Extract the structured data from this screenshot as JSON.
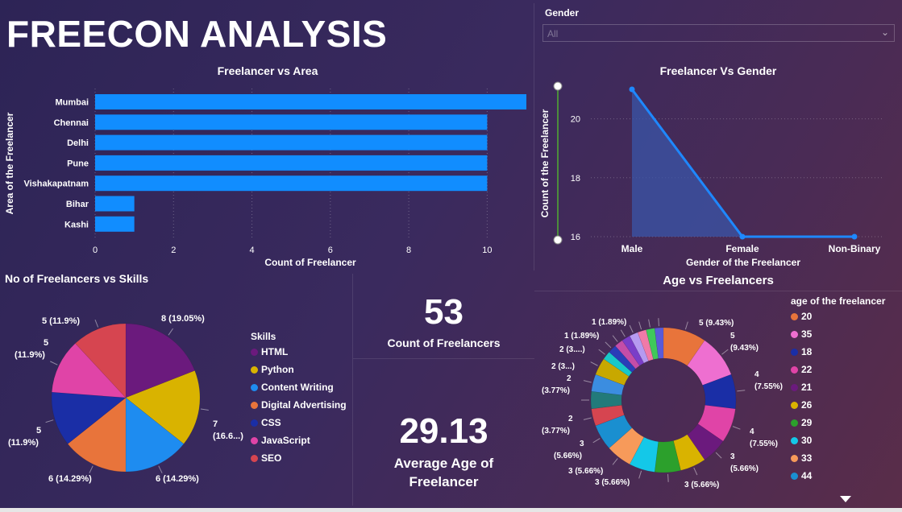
{
  "report_title": "FREECON ANALYSIS",
  "slicer": {
    "label": "Gender",
    "value": "All"
  },
  "cards": {
    "count": {
      "value": "53",
      "label": "Count of Freelancers"
    },
    "avg_age": {
      "value": "29.13",
      "label_line1": "Average Age of",
      "label_line2": "Freelancer"
    }
  },
  "colors": {
    "bar": "#118dff",
    "line": "#1e88ff",
    "area": "#3a56a8"
  },
  "chart_data": [
    {
      "id": "area",
      "type": "bar",
      "orientation": "horizontal",
      "title": "Freelancer vs Area",
      "xlabel": "Count of Freelancer",
      "ylabel": "Area of the Freelancer",
      "categories": [
        "Mumbai",
        "Chennai",
        "Delhi",
        "Pune",
        "Vishakapatnam",
        "Bihar",
        "Kashi"
      ],
      "values": [
        11,
        10,
        10,
        10,
        10,
        1,
        1
      ],
      "xlim": [
        0,
        11
      ],
      "xticks": [
        "0",
        "2",
        "4",
        "6",
        "8",
        "10"
      ],
      "grid": true
    },
    {
      "id": "gender",
      "type": "area",
      "title": "Freelancer Vs Gender",
      "xlabel": "Gender of the Freelancer",
      "ylabel": "Count of the Freelancer",
      "categories": [
        "Male",
        "Female",
        "Non-Binary"
      ],
      "values": [
        21,
        16,
        16
      ],
      "ylim": [
        16,
        21
      ],
      "yticks": [
        "16",
        "18",
        "20"
      ],
      "grid": true
    },
    {
      "id": "skills",
      "type": "pie",
      "title": "No of Freelancers vs Skills",
      "legend_title": "Skills",
      "slices": [
        {
          "name": "HTML",
          "value": 8,
          "label": "8 (19.05%)",
          "color": "#6b1a7d"
        },
        {
          "name": "Python",
          "value": 7,
          "label1": "7",
          "label2": "(16.6...)",
          "color": "#d9b300"
        },
        {
          "name": "Content Writing",
          "value": 6,
          "label": "6 (14.29%)",
          "color": "#1e8cf0"
        },
        {
          "name": "Digital Advertising",
          "value": 6,
          "label": "6 (14.29%)",
          "color": "#e8743b"
        },
        {
          "name": "CSS",
          "value": 5,
          "label1": "5",
          "label2": "(11.9%)",
          "color": "#1a2ea6"
        },
        {
          "name": "JavaScript",
          "value": 5,
          "label1": "5",
          "label2": "(11.9%)",
          "color": "#e044a7"
        },
        {
          "name": "SEO",
          "value": 5,
          "label": "5 (11.9%)",
          "color": "#d64550"
        }
      ]
    },
    {
      "id": "age",
      "type": "pie",
      "donut": true,
      "title": "Age vs Freelancers",
      "legend_title": "age of the freelancer",
      "slices": [
        {
          "name": "20",
          "value": 5,
          "color": "#e8743b"
        },
        {
          "name": "35",
          "value": 5,
          "color": "#ee6fd0"
        },
        {
          "name": "18",
          "value": 4,
          "color": "#1a2ea6"
        },
        {
          "name": "22",
          "value": 4,
          "color": "#e044a7"
        },
        {
          "name": "21",
          "value": 3,
          "color": "#6b1a7d"
        },
        {
          "name": "26",
          "value": 3,
          "color": "#d9b300"
        },
        {
          "name": "29",
          "value": 3,
          "color": "#2ca02c"
        },
        {
          "name": "30",
          "value": 3,
          "color": "#14c8e8"
        },
        {
          "name": "33",
          "value": 3,
          "color": "#f79a5a"
        },
        {
          "name": "44",
          "value": 3,
          "color": "#1a8fd0"
        },
        {
          "name": "",
          "value": 2,
          "color": "#d64550"
        },
        {
          "name": "",
          "value": 2,
          "color": "#227a7a"
        },
        {
          "name": "",
          "value": 2,
          "color": "#3b8de0"
        },
        {
          "name": "",
          "value": 2,
          "color": "#c8a800"
        },
        {
          "name": "",
          "value": 1,
          "color": "#19c8c8"
        },
        {
          "name": "",
          "value": 1,
          "color": "#2a3db8"
        },
        {
          "name": "",
          "value": 1,
          "color": "#c44da8"
        },
        {
          "name": "",
          "value": 1,
          "color": "#7a3ec8"
        },
        {
          "name": "",
          "value": 1,
          "color": "#b69af0"
        },
        {
          "name": "",
          "value": 1,
          "color": "#f07aa8"
        },
        {
          "name": "",
          "value": 1,
          "color": "#3fc85a"
        },
        {
          "name": "",
          "value": 1,
          "color": "#5a5ad8"
        }
      ],
      "labels": {
        "l1": "5 (9.43%)",
        "l2a": "5",
        "l2b": "(9.43%)",
        "l3a": "4",
        "l3b": "(7.55%)",
        "l4a": "4",
        "l4b": "(7.55%)",
        "l5a": "3",
        "l5b": "(5.66%)",
        "l6": "3 (5.66%)",
        "l7": "3 (5.66%)",
        "l8": "3 (5.66%)",
        "l9a": "3",
        "l9b": "(5.66%)",
        "l10a": "2",
        "l10b": "(3.77%)",
        "l11a": "2",
        "l11b": "(3.77%)",
        "l12": "2 (3...)",
        "l13": "2 (3....)",
        "l14": "1 (1.89%)",
        "l15": "1 (1.89%)"
      }
    }
  ]
}
